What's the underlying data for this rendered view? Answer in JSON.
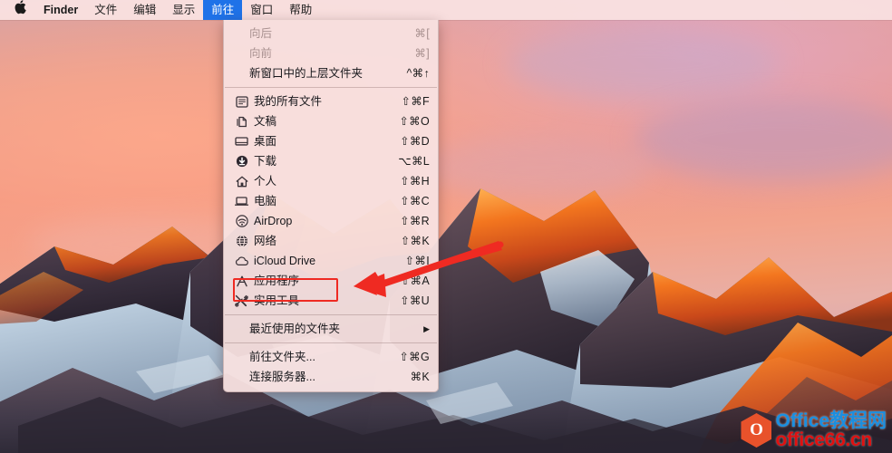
{
  "menubar": {
    "apple_icon": "apple-logo",
    "items": [
      {
        "label": "Finder",
        "bold": true,
        "active": false
      },
      {
        "label": "文件",
        "bold": false,
        "active": false
      },
      {
        "label": "编辑",
        "bold": false,
        "active": false
      },
      {
        "label": "显示",
        "bold": false,
        "active": false
      },
      {
        "label": "前往",
        "bold": false,
        "active": true
      },
      {
        "label": "窗口",
        "bold": false,
        "active": false
      },
      {
        "label": "帮助",
        "bold": false,
        "active": false
      }
    ],
    "highlight_color": "#1f72e8"
  },
  "go_menu": {
    "groups": [
      {
        "items": [
          {
            "label": "向后",
            "shortcut": "⌘[",
            "icon": "none",
            "disabled": true
          },
          {
            "label": "向前",
            "shortcut": "⌘]",
            "icon": "none",
            "disabled": true
          },
          {
            "label": "新窗口中的上层文件夹",
            "shortcut": "^⌘↑",
            "icon": "none",
            "disabled": false
          }
        ]
      },
      {
        "items": [
          {
            "label": "我的所有文件",
            "shortcut": "⇧⌘F",
            "icon": "all-files-icon",
            "disabled": false
          },
          {
            "label": "文稿",
            "shortcut": "⇧⌘O",
            "icon": "documents-icon",
            "disabled": false
          },
          {
            "label": "桌面",
            "shortcut": "⇧⌘D",
            "icon": "desktop-icon",
            "disabled": false
          },
          {
            "label": "下载",
            "shortcut": "⌥⌘L",
            "icon": "downloads-icon",
            "disabled": false
          },
          {
            "label": "个人",
            "shortcut": "⇧⌘H",
            "icon": "home-icon",
            "disabled": false
          },
          {
            "label": "电脑",
            "shortcut": "⇧⌘C",
            "icon": "computer-icon",
            "disabled": false
          },
          {
            "label": "AirDrop",
            "shortcut": "⇧⌘R",
            "icon": "airdrop-icon",
            "disabled": false
          },
          {
            "label": "网络",
            "shortcut": "⇧⌘K",
            "icon": "network-icon",
            "disabled": false
          },
          {
            "label": "iCloud Drive",
            "shortcut": "⇧⌘I",
            "icon": "icloud-icon",
            "disabled": false
          },
          {
            "label": "应用程序",
            "shortcut": "⇧⌘A",
            "icon": "applications-icon",
            "disabled": false
          },
          {
            "label": "实用工具",
            "shortcut": "⇧⌘U",
            "icon": "utilities-icon",
            "disabled": false,
            "highlighted": true
          }
        ]
      },
      {
        "items": [
          {
            "label": "最近使用的文件夹",
            "shortcut": "",
            "icon": "none",
            "submenu": true,
            "disabled": false
          }
        ]
      },
      {
        "items": [
          {
            "label": "前往文件夹...",
            "shortcut": "⇧⌘G",
            "icon": "none",
            "disabled": false
          },
          {
            "label": "连接服务器...",
            "shortcut": "⌘K",
            "icon": "none",
            "disabled": false
          }
        ]
      }
    ]
  },
  "annotation": {
    "highlight_target": "实用工具",
    "highlight_color": "#ef2a22",
    "arrow_color": "#ef2a22"
  },
  "watermark": {
    "logo_letter": "O",
    "line1_en": "Office",
    "line1_cn": "教程网",
    "line2": "office66.cn",
    "line1_color": "#1a8fe0",
    "line2_color": "#e01010",
    "logo_color": "#e8522b"
  }
}
